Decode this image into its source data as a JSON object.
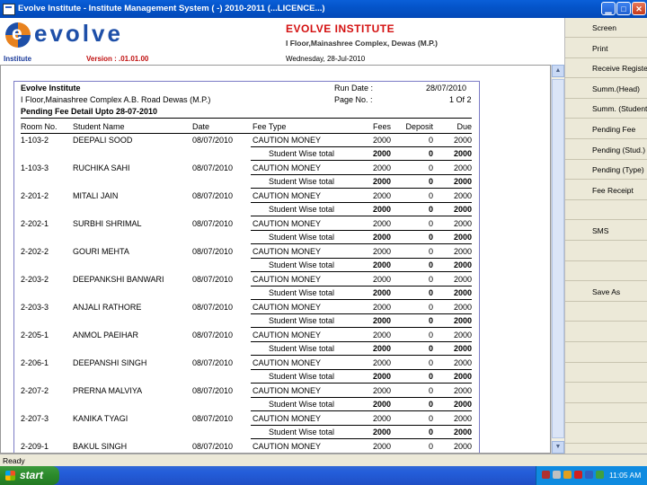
{
  "window": {
    "title": "Evolve Institute - Institute Management System ( -) 2010-2011 (...LICENCE...)"
  },
  "header": {
    "logo_text": "evolve",
    "institute_name": "EVOLVE INSTITUTE",
    "address": "I Floor,Mainashree Complex, Dewas (M.P.)"
  },
  "infobar": {
    "institute_label": "Institute",
    "version": "Version : .01.01.00",
    "date": "Wednesday, 28-Jul-2010"
  },
  "report": {
    "institute": "Evolve Institute",
    "address": "I Floor,Mainashree Complex A.B. Road Dewas (M.P.)",
    "title": "Pending Fee Detail Upto 28-07-2010",
    "run_date_label": "Run Date :",
    "run_date": "28/07/2010",
    "page_label": "Page No. :",
    "page_value": "1 Of 2",
    "columns": [
      "Room No.",
      "Student Name",
      "Date",
      "Fee Type",
      "Fees",
      "Deposit",
      "Due"
    ],
    "rows": [
      {
        "room": "1-103-2",
        "name": "DEEPALI  SOOD",
        "date": "08/07/2010",
        "fee_type": "CAUTION MONEY",
        "fees": "2000",
        "deposit": "0",
        "due": "2000"
      },
      {
        "room": "1-103-3",
        "name": "RUCHIKA  SAHI",
        "date": "08/07/2010",
        "fee_type": "CAUTION MONEY",
        "fees": "2000",
        "deposit": "0",
        "due": "2000"
      },
      {
        "room": "2-201-2",
        "name": "MITALI  JAIN",
        "date": "08/07/2010",
        "fee_type": "CAUTION MONEY",
        "fees": "2000",
        "deposit": "0",
        "due": "2000"
      },
      {
        "room": "2-202-1",
        "name": "SURBHI  SHRIMAL",
        "date": "08/07/2010",
        "fee_type": "CAUTION MONEY",
        "fees": "2000",
        "deposit": "0",
        "due": "2000"
      },
      {
        "room": "2-202-2",
        "name": "GOURI  MEHTA",
        "date": "08/07/2010",
        "fee_type": "CAUTION MONEY",
        "fees": "2000",
        "deposit": "0",
        "due": "2000"
      },
      {
        "room": "2-203-2",
        "name": "DEEPANKSHI  BANWARI",
        "date": "08/07/2010",
        "fee_type": "CAUTION MONEY",
        "fees": "2000",
        "deposit": "0",
        "due": "2000"
      },
      {
        "room": "2-203-3",
        "name": "ANJALI  RATHORE",
        "date": "08/07/2010",
        "fee_type": "CAUTION MONEY",
        "fees": "2000",
        "deposit": "0",
        "due": "2000"
      },
      {
        "room": "2-205-1",
        "name": "ANMOL  PAEIHAR",
        "date": "08/07/2010",
        "fee_type": "CAUTION MONEY",
        "fees": "2000",
        "deposit": "0",
        "due": "2000"
      },
      {
        "room": "2-206-1",
        "name": "DEEPANSHI  SINGH",
        "date": "08/07/2010",
        "fee_type": "CAUTION MONEY",
        "fees": "2000",
        "deposit": "0",
        "due": "2000"
      },
      {
        "room": "2-207-2",
        "name": "PRERNA  MALVIYA",
        "date": "08/07/2010",
        "fee_type": "CAUTION MONEY",
        "fees": "2000",
        "deposit": "0",
        "due": "2000"
      },
      {
        "room": "2-207-3",
        "name": "KANIKA  TYAGI",
        "date": "08/07/2010",
        "fee_type": "CAUTION MONEY",
        "fees": "2000",
        "deposit": "0",
        "due": "2000"
      },
      {
        "room": "2-209-1",
        "name": "BAKUL  SINGH",
        "date": "08/07/2010",
        "fee_type": "CAUTION MONEY",
        "fees": "2000",
        "deposit": "0",
        "due": "2000"
      }
    ],
    "subtotal": {
      "label": "Student Wise total",
      "fees": "2000",
      "deposit": "0",
      "due": "2000"
    }
  },
  "sidebar": {
    "buttons": [
      "Screen",
      "Print",
      "Receive Register",
      "Summ.(Head)",
      "Summ. (Student)",
      "Pending Fee",
      "Pending (Stud.)",
      "Pending (Type)",
      "Fee Receipt",
      "",
      "SMS",
      "",
      "",
      "Save As",
      "",
      "",
      "",
      "",
      "",
      "",
      ""
    ]
  },
  "status": {
    "text": "Ready"
  },
  "taskbar": {
    "start_label": "start",
    "clock": "11:05 AM"
  },
  "colors": {
    "title_blue": "#0454c9",
    "brand_red": "#d41010",
    "brand_blue": "#1e4fa8",
    "panel_bg": "#ece9d8"
  },
  "icons": [
    "app-icon",
    "minimize-icon",
    "maximize-icon",
    "close-icon",
    "scroll-up-icon",
    "scroll-down-icon",
    "windows-flag-icon"
  ]
}
